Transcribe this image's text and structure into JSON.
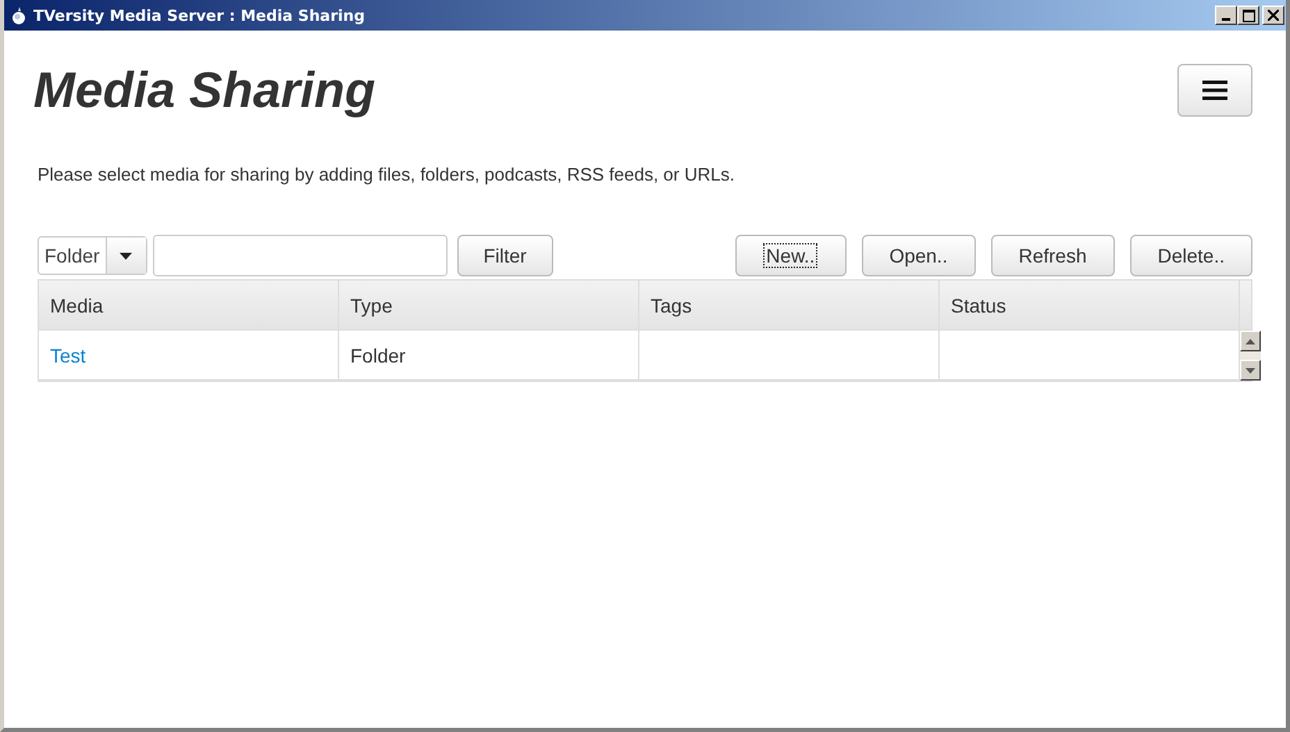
{
  "window": {
    "title": "TVersity Media Server : Media Sharing"
  },
  "page": {
    "title": "Media Sharing",
    "description": "Please select media for sharing by adding files, folders, podcasts, RSS feeds, or URLs."
  },
  "toolbar": {
    "type_select": "Folder",
    "filter_button": "Filter",
    "buttons": [
      {
        "label": "New..",
        "focused": true
      },
      {
        "label": "Open..",
        "focused": false
      },
      {
        "label": "Refresh",
        "focused": false
      },
      {
        "label": "Delete..",
        "focused": false
      }
    ]
  },
  "table": {
    "columns": [
      "Media",
      "Type",
      "Tags",
      "Status"
    ],
    "rows": [
      {
        "media": "Test",
        "type": "Folder"
      }
    ]
  }
}
